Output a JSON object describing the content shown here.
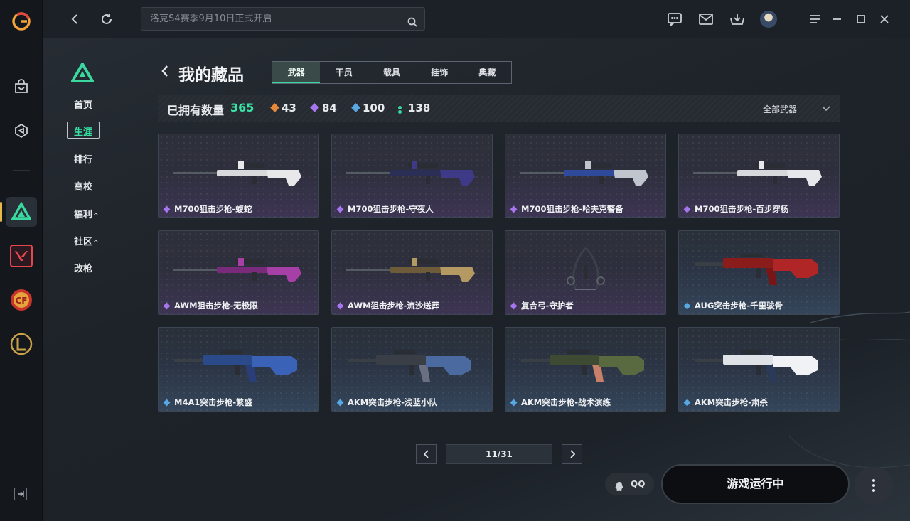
{
  "topbar": {
    "search_placeholder": "洛克S4赛季9月10日正式开启"
  },
  "submenu": {
    "items": [
      {
        "label": "首页"
      },
      {
        "label": "生涯"
      },
      {
        "label": "排行"
      },
      {
        "label": "高校"
      },
      {
        "label": "福利",
        "caret": "^"
      },
      {
        "label": "社区",
        "caret": "^"
      },
      {
        "label": "改枪"
      }
    ]
  },
  "page": {
    "title": "我的藏品",
    "tabs": [
      "武器",
      "干员",
      "载具",
      "挂饰",
      "典藏"
    ]
  },
  "stats": {
    "owned_label": "已拥有数量",
    "total": "365",
    "counts": [
      {
        "value": "43",
        "color": "#e8883a"
      },
      {
        "value": "84",
        "color": "#a875f0"
      },
      {
        "value": "100",
        "color": "#58a9e3"
      },
      {
        "value": "138",
        "color": "#39d9a0"
      }
    ],
    "filter_label": "全部武器"
  },
  "cards": [
    {
      "name": "M700狙击步枪-蝮蛇",
      "rarity": "purple"
    },
    {
      "name": "M700狙击步枪-守夜人",
      "rarity": "purple"
    },
    {
      "name": "M700狙击步枪-哈夫克警备",
      "rarity": "purple"
    },
    {
      "name": "M700狙击步枪-百步穿杨",
      "rarity": "purple"
    },
    {
      "name": "AWM狙击步枪-无极限",
      "rarity": "purple"
    },
    {
      "name": "AWM狙击步枪-流沙送葬",
      "rarity": "purple"
    },
    {
      "name": "复合弓-守护者",
      "rarity": "purple"
    },
    {
      "name": "AUG突击步枪-千里骏骨",
      "rarity": "blue"
    },
    {
      "name": "M4A1突击步枪-繁盛",
      "rarity": "blue"
    },
    {
      "name": "AKM突击步枪-浅蓝小队",
      "rarity": "blue"
    },
    {
      "name": "AKM突击步枪-战术演练",
      "rarity": "blue"
    },
    {
      "name": "AKM突击步枪-肃杀",
      "rarity": "blue"
    }
  ],
  "pager": {
    "label": "11/31"
  },
  "bottom": {
    "qq_label": "QQ",
    "run_label": "游戏运行中"
  },
  "colors": {
    "accent": "#39d9a0",
    "rarity_purple": "#a875f0",
    "rarity_blue": "#58a9e3"
  }
}
